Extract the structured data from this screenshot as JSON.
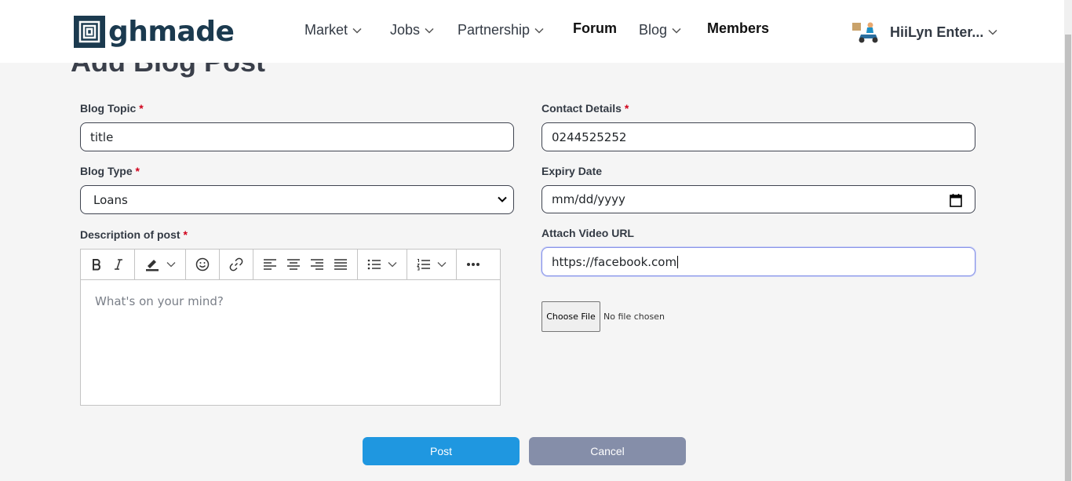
{
  "brand": {
    "logo_text": "ghmade"
  },
  "nav": {
    "items": [
      {
        "label": "Market",
        "dropdown": true
      },
      {
        "label": "Jobs",
        "dropdown": true
      },
      {
        "label": "Partnership",
        "dropdown": true
      },
      {
        "label": "Forum",
        "dropdown": false
      },
      {
        "label": "Blog",
        "dropdown": true
      },
      {
        "label": "Members",
        "dropdown": false
      }
    ]
  },
  "account": {
    "name": "HiiLyn Enter..."
  },
  "page": {
    "title": "Add Blog Post"
  },
  "form": {
    "blog_topic": {
      "label": "Blog Topic",
      "required": "*",
      "value": "title"
    },
    "blog_type": {
      "label": "Blog Type",
      "required": "*",
      "value": "Loans"
    },
    "description": {
      "label": "Description of post",
      "required": "*",
      "placeholder": "What's on your mind?"
    },
    "contact": {
      "label": "Contact Details",
      "required": "*",
      "value": "0244525252"
    },
    "expiry": {
      "label": "Expiry Date",
      "value": "mm/dd/yyyy"
    },
    "video": {
      "label": "Attach Video URL",
      "value": "https://facebook.com"
    },
    "file": {
      "button": "Choose File",
      "status": "No file chosen"
    }
  },
  "actions": {
    "post": "Post",
    "cancel": "Cancel"
  },
  "colors": {
    "primary": "#1f97e0",
    "secondary": "#858ea9",
    "brand": "#1b3a4f",
    "required": "#d0021b"
  }
}
